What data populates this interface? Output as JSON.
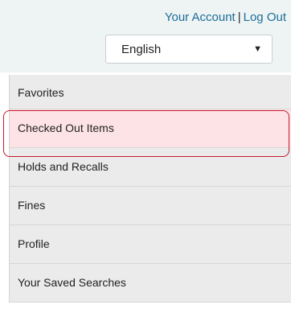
{
  "header": {
    "account_link": "Your Account",
    "separator": "|",
    "logout_link": "Log Out",
    "language_select": {
      "selected": "English",
      "caret": "▼"
    }
  },
  "menu": {
    "items": [
      {
        "label": "Favorites"
      },
      {
        "label": "Checked Out Items",
        "highlighted": true
      },
      {
        "label": "Holds and Recalls"
      },
      {
        "label": "Fines"
      },
      {
        "label": "Profile"
      },
      {
        "label": "Your Saved Searches"
      }
    ]
  },
  "colors": {
    "link": "#1c6e98",
    "header_bg": "#eef3f4",
    "menu_bg": "#ebebeb",
    "highlight_bg": "#fde3e6",
    "highlight_border": "#c61a2d"
  }
}
